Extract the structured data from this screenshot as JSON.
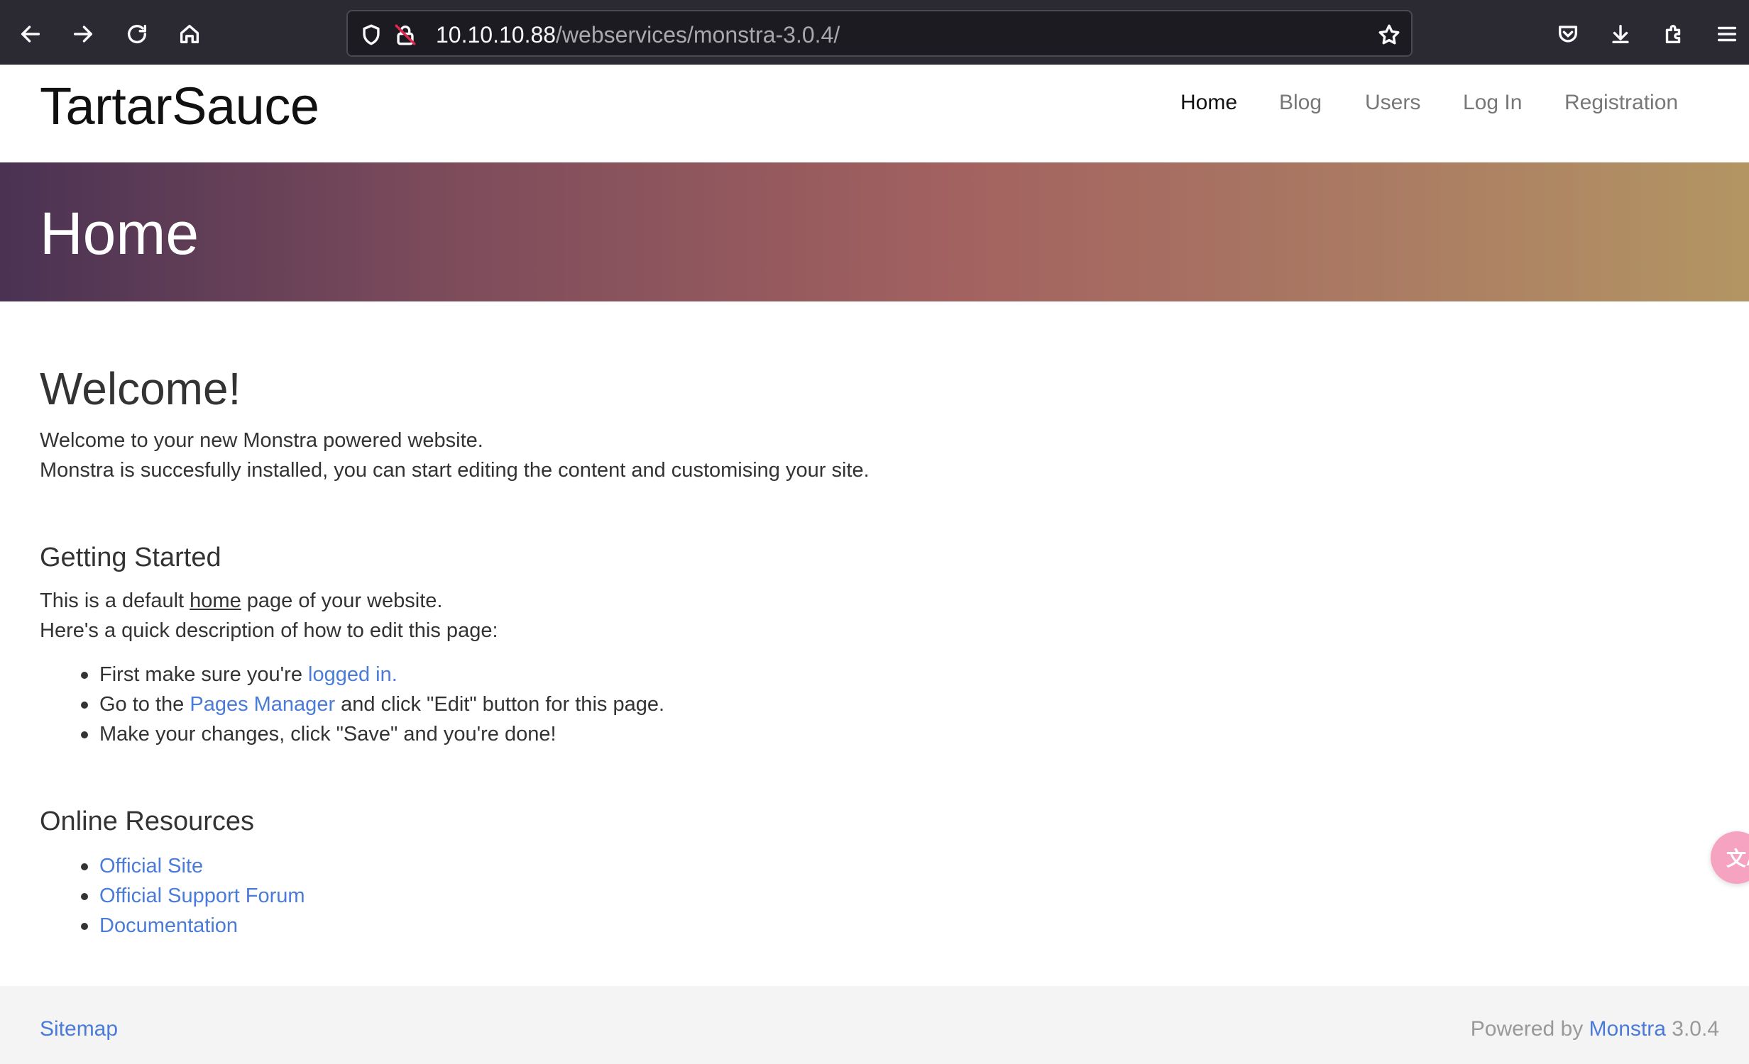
{
  "browser": {
    "url_host": "10.10.10.88",
    "url_path": "/webservices/monstra-3.0.4/"
  },
  "site": {
    "brand": "TartarSauce",
    "nav": [
      {
        "label": "Home",
        "active": true
      },
      {
        "label": "Blog",
        "active": false
      },
      {
        "label": "Users",
        "active": false
      },
      {
        "label": "Log In",
        "active": false
      },
      {
        "label": "Registration",
        "active": false
      }
    ]
  },
  "banner": {
    "title": "Home"
  },
  "content": {
    "welcome_title": "Welcome!",
    "welcome_line1": "Welcome to your new Monstra powered website.",
    "welcome_line2": "Monstra is succesfully installed, you can start editing the content and customising your site.",
    "getting_started": {
      "title": "Getting Started",
      "line1_before": "This is a default ",
      "line1_home": "home",
      "line1_after": " page of your website.",
      "line2": "Here's a quick description of how to edit this page:",
      "steps": [
        {
          "before": "First make sure you're ",
          "link": "logged in.",
          "after": ""
        },
        {
          "before": "Go to the ",
          "link": "Pages Manager",
          "after": " and click \"Edit\" button for this page."
        },
        {
          "before": "Make your changes, click \"Save\" and you're done!",
          "link": "",
          "after": ""
        }
      ]
    },
    "online_resources": {
      "title": "Online Resources",
      "links": [
        "Official Site",
        "Official Support Forum",
        "Documentation"
      ]
    }
  },
  "footer": {
    "sitemap": "Sitemap",
    "powered_by": "Powered by",
    "monstra": "Monstra",
    "version": "3.0.4"
  },
  "widget": {
    "label": "文A"
  },
  "colors": {
    "link": "#4a7bd8",
    "chrome_bg": "#2b2a33",
    "banner_start": "#4a3253",
    "banner_mid": "#a36260",
    "banner_end": "#b39563"
  }
}
